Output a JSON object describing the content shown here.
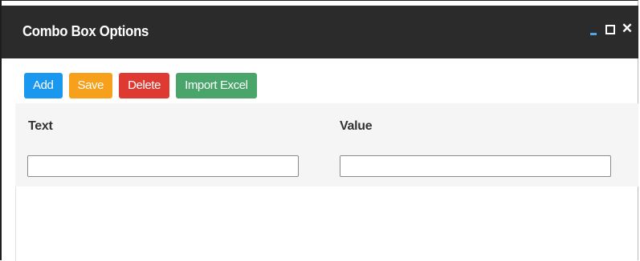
{
  "window": {
    "title": "Combo Box Options",
    "controls": [
      "minimize-icon",
      "maximize-icon",
      "close-icon"
    ],
    "close_glyph": "✕"
  },
  "toolbar": {
    "add_label": "Add",
    "save_label": "Save",
    "delete_label": "Delete",
    "import_label": "Import Excel"
  },
  "colors": {
    "titlebar": "#2b2b2b",
    "add": "#1a98f0",
    "save": "#f7a01b",
    "delete": "#de3a32",
    "import": "#4aa56a",
    "form_background": "#f5f5f5"
  },
  "form": {
    "text_label": "Text",
    "text_value": "",
    "value_label": "Value",
    "value_value": ""
  }
}
